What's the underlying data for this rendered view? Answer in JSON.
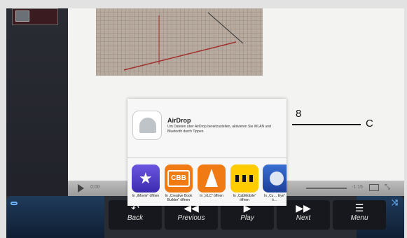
{
  "share_sheet": {
    "airdrop_title": "AirDrop",
    "airdrop_description": "Um Dateien über AirDrop bereitzustellen, aktivieren Sie WLAN und Bluetooth durch Tippen.",
    "apps": [
      {
        "label": "In „iMovie“ öffnen",
        "icon": "imovie-icon"
      },
      {
        "label": "In „Creative Book Builder“ öffnen",
        "icon": "cbb-icon"
      },
      {
        "label": "In „VLC“ öffnen",
        "icon": "vlc-icon"
      },
      {
        "label": "In „CabMobile“ öffnen",
        "icon": "cabmobile-icon"
      },
      {
        "label": "In „Cu… Eye“ ö…",
        "icon": "app-icon"
      }
    ],
    "cbb_text": "CBB"
  },
  "document": {
    "eq_numerator": "8",
    "eq_right": "C"
  },
  "player": {
    "time_left": "0:00",
    "time_right": "-1:15"
  },
  "toolbar": {
    "back": "Back",
    "previous": "Previous",
    "play": "Play",
    "next": "Next",
    "menu": "Menu"
  },
  "colors": {
    "toolbar_accent": "#6ab2ff",
    "cbb_orange": "#f07b15",
    "cab_yellow": "#ffcc00"
  }
}
